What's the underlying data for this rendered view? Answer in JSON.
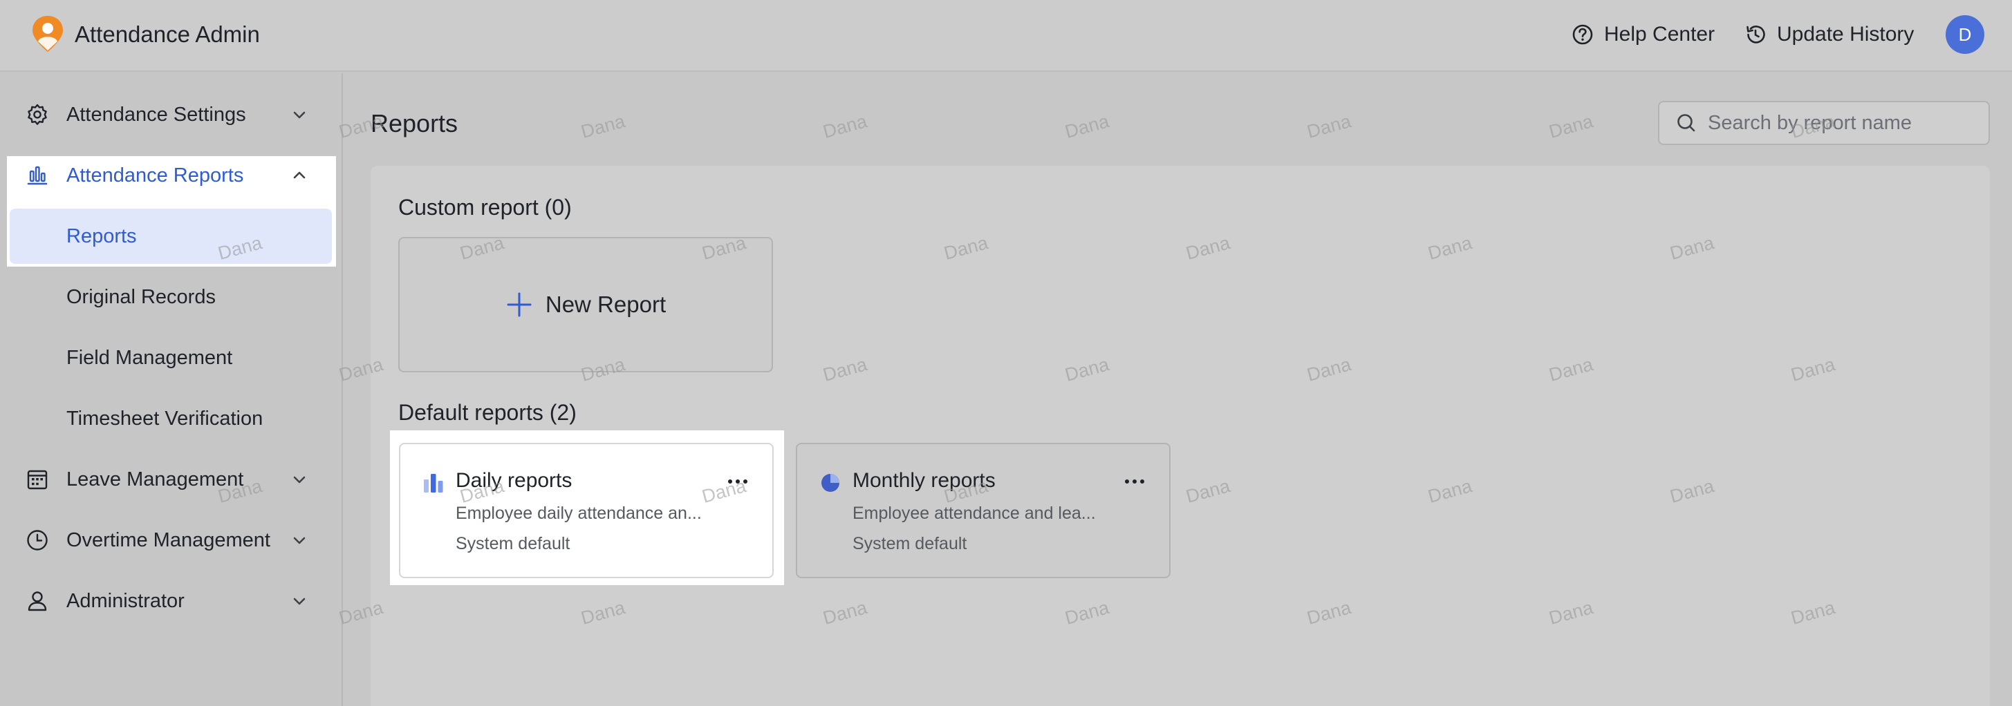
{
  "header": {
    "app_title": "Attendance Admin",
    "help_center": "Help Center",
    "update_history": "Update History",
    "avatar_initial": "D",
    "avatar_color": "#4a6fd8"
  },
  "sidebar": {
    "items": [
      {
        "label": "Attendance Settings",
        "icon": "gear-icon",
        "expanded": false
      },
      {
        "label": "Attendance Reports",
        "icon": "bar-chart-icon",
        "expanded": true,
        "children": [
          {
            "label": "Reports",
            "active": true
          },
          {
            "label": "Original Records"
          },
          {
            "label": "Field Management"
          },
          {
            "label": "Timesheet Verification"
          }
        ]
      },
      {
        "label": "Leave Management",
        "icon": "calendar-icon",
        "expanded": false
      },
      {
        "label": "Overtime Management",
        "icon": "clock-icon",
        "expanded": false
      },
      {
        "label": "Administrator",
        "icon": "user-icon",
        "expanded": false
      }
    ]
  },
  "main": {
    "title": "Reports",
    "search": {
      "placeholder": "Search by report name",
      "value": ""
    },
    "custom_section": {
      "title": "Custom report (0)",
      "new_report_label": "New Report"
    },
    "default_section": {
      "title": "Default reports (2)",
      "reports": [
        {
          "name": "Daily reports",
          "description": "Employee daily attendance an...",
          "type": "System default",
          "icon": "bar-chart-icon"
        },
        {
          "name": "Monthly reports",
          "description": "Employee attendance and lea...",
          "type": "System default",
          "icon": "pie-chart-icon"
        }
      ]
    }
  },
  "watermark": "Dana",
  "colors": {
    "accent": "#2f5bd3",
    "active_bg": "#e1e7fb",
    "logo_orange": "#f08a24"
  }
}
